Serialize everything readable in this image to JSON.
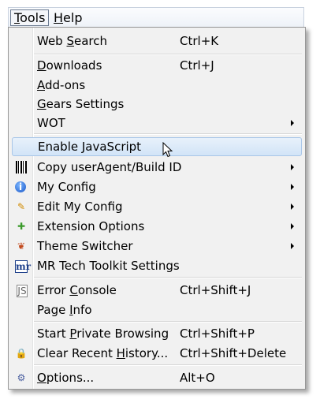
{
  "menubar": {
    "tools": {
      "pre": "",
      "ul": "T",
      "post": "ools"
    },
    "help": {
      "pre": "",
      "ul": "H",
      "post": "elp"
    }
  },
  "menu": {
    "items": [
      {
        "pre": "Web ",
        "ul": "S",
        "post": "earch",
        "shortcut": "Ctrl+K"
      },
      {
        "pre": "",
        "ul": "D",
        "post": "ownloads",
        "shortcut": "Ctrl+J"
      },
      {
        "pre": "",
        "ul": "A",
        "post": "dd-ons",
        "shortcut": ""
      },
      {
        "pre": "",
        "ul": "G",
        "post": "ears Settings",
        "shortcut": ""
      },
      {
        "pre": "WOT",
        "ul": "",
        "post": "",
        "shortcut": "",
        "submenu": true
      },
      {
        "pre": "Enable JavaScript",
        "ul": "",
        "post": "",
        "shortcut": "",
        "highlighted": true
      },
      {
        "pre": "Copy userAgent/Build ID",
        "ul": "",
        "post": "",
        "shortcut": "",
        "icon": "barcode-icon",
        "submenu": true
      },
      {
        "pre": "My Config",
        "ul": "",
        "post": "",
        "shortcut": "",
        "icon": "info-icon",
        "submenu": true
      },
      {
        "pre": "Edit My Config",
        "ul": "",
        "post": "",
        "shortcut": "",
        "icon": "edit-icon",
        "submenu": true
      },
      {
        "pre": "Extension Options",
        "ul": "",
        "post": "",
        "shortcut": "",
        "icon": "puzzle-icon",
        "submenu": true
      },
      {
        "pre": "Theme Switcher",
        "ul": "",
        "post": "",
        "shortcut": "",
        "icon": "palette-icon",
        "submenu": true
      },
      {
        "pre": "MR Tech Toolkit Settings",
        "ul": "",
        "post": "",
        "shortcut": "",
        "icon": "mr-tech-icon"
      },
      {
        "pre": "Error ",
        "ul": "C",
        "post": "onsole",
        "shortcut": "Ctrl+Shift+J",
        "icon": "js-file-icon"
      },
      {
        "pre": "Page ",
        "ul": "I",
        "post": "nfo",
        "shortcut": ""
      },
      {
        "pre": "Start ",
        "ul": "P",
        "post": "rivate Browsing",
        "shortcut": "Ctrl+Shift+P"
      },
      {
        "pre": "Clear Recent ",
        "ul": "H",
        "post": "istory...",
        "shortcut": "Ctrl+Shift+Delete",
        "icon": "lock-icon"
      },
      {
        "pre": "",
        "ul": "O",
        "post": "ptions...",
        "shortcut": "Alt+O",
        "icon": "gear-icon"
      }
    ]
  },
  "icons": {
    "barcode-icon": "",
    "info-icon": "i",
    "edit-icon": "✎",
    "puzzle-icon": "✚",
    "palette-icon": "❦",
    "mr-tech-icon": "mr",
    "js-file-icon": "JS",
    "lock-icon": "🔒",
    "gear-icon": "⚙"
  }
}
